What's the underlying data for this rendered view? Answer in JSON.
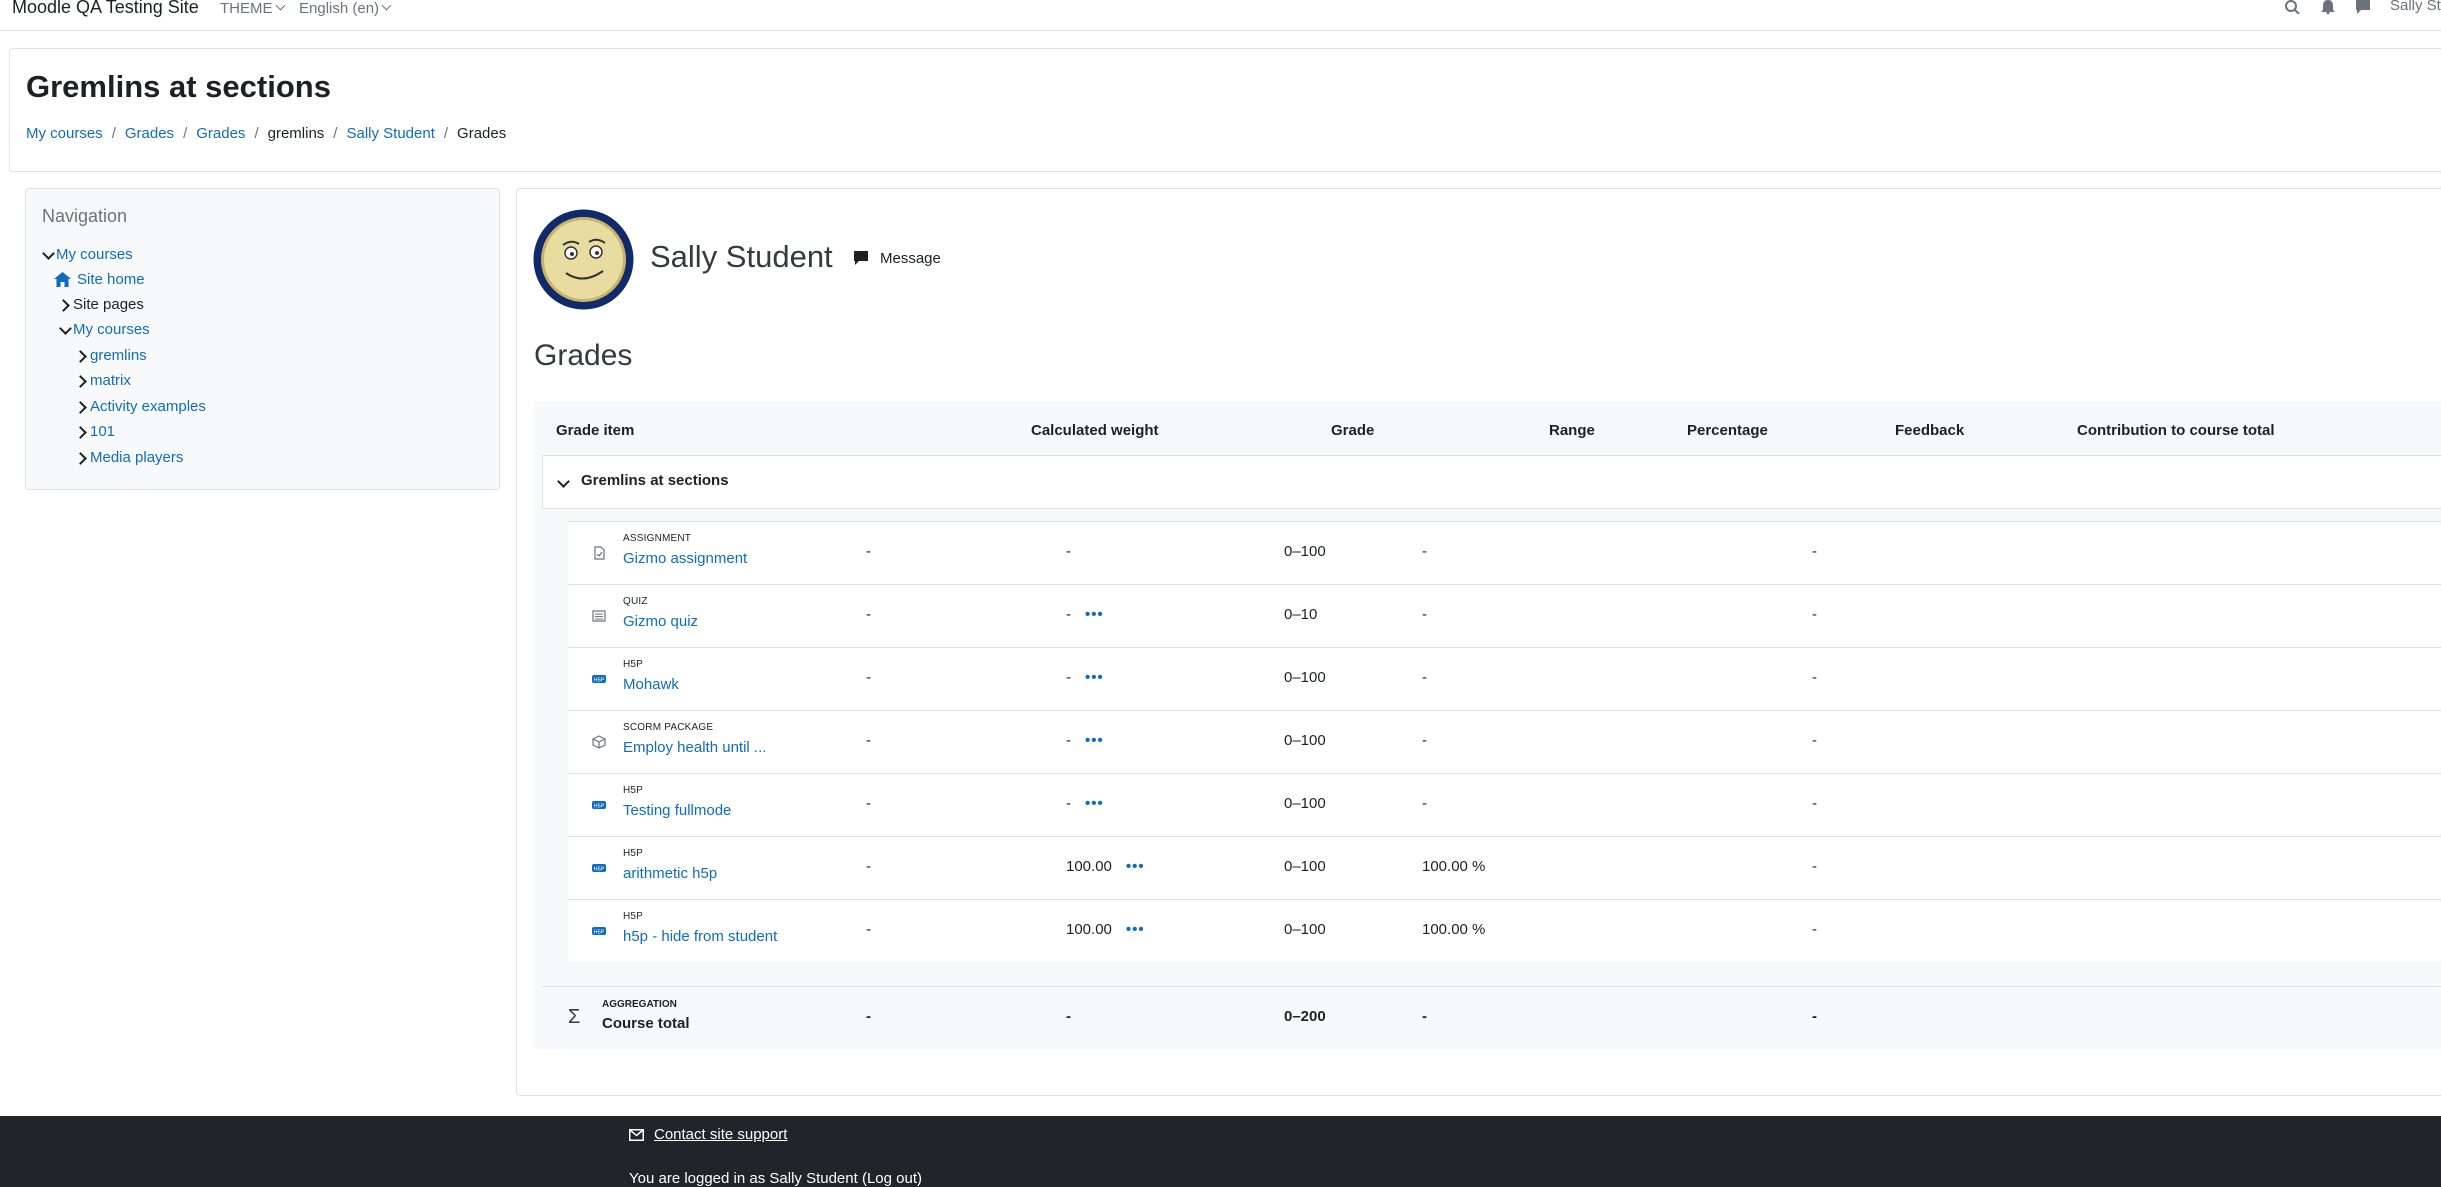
{
  "navbar": {
    "brand": "Moodle QA Testing Site",
    "theme_label": "THEME",
    "language_label": "English (en)",
    "user_label": "Sally St",
    "icons": [
      "search-icon",
      "bell-icon",
      "chat-icon"
    ]
  },
  "header": {
    "title": "Gremlins at sections",
    "breadcrumb": [
      "My courses",
      "Grades",
      "Grades",
      "gremlins",
      "Sally Student",
      "Grades"
    ]
  },
  "navigation": {
    "title": "Navigation",
    "items": [
      "My courses",
      "Site home",
      "Site pages",
      "My courses",
      "gremlins",
      "matrix",
      "Activity examples",
      "101",
      "Media players"
    ]
  },
  "profile": {
    "name": "Sally Student",
    "message_label": "Message"
  },
  "grades": {
    "heading": "Grades",
    "columns": [
      "Grade item",
      "Calculated weight",
      "Grade",
      "Range",
      "Percentage",
      "Feedback",
      "Contribution to course total"
    ],
    "category": "Gremlins at sections",
    "items": [
      {
        "type": "ASSIGNMENT",
        "name": "Gizmo assignment",
        "weight": "-",
        "grade": "-",
        "range": "0–100",
        "percentage": "-",
        "feedback": "",
        "contribution": "-"
      },
      {
        "type": "QUIZ",
        "name": "Gizmo quiz",
        "weight": "-",
        "grade": "-",
        "range": "0–10",
        "percentage": "-",
        "feedback": "",
        "contribution": "-"
      },
      {
        "type": "H5P",
        "name": "Mohawk",
        "weight": "-",
        "grade": "-",
        "range": "0–100",
        "percentage": "-",
        "feedback": "",
        "contribution": "-"
      },
      {
        "type": "SCORM PACKAGE",
        "name": "Employ health until ...",
        "weight": "-",
        "grade": "-",
        "range": "0–100",
        "percentage": "-",
        "feedback": "",
        "contribution": "-"
      },
      {
        "type": "H5P",
        "name": "Testing fullmode",
        "weight": "-",
        "grade": "-",
        "range": "0–100",
        "percentage": "-",
        "feedback": "",
        "contribution": "-"
      },
      {
        "type": "H5P",
        "name": "arithmetic h5p",
        "weight": "-",
        "grade": "100.00",
        "range": "0–100",
        "percentage": "100.00 %",
        "feedback": "",
        "contribution": "-"
      },
      {
        "type": "H5P",
        "name": "h5p - hide from student",
        "weight": "-",
        "grade": "100.00",
        "range": "0–100",
        "percentage": "100.00 %",
        "feedback": "",
        "contribution": "-"
      }
    ],
    "actions_glyph": "•••",
    "total": {
      "type": "AGGREGATION",
      "name": "Course total",
      "weight": "-",
      "grade": "-",
      "range": "0–200",
      "percentage": "-",
      "contribution": "-"
    }
  },
  "footer": {
    "support_label": "Contact site support",
    "logged_in_text": "You are logged in as Sally Student (Log out)"
  },
  "colors": {
    "link": "#0f6cbf",
    "footer_bg": "#212529",
    "panel_bg": "#f8f9fa"
  }
}
